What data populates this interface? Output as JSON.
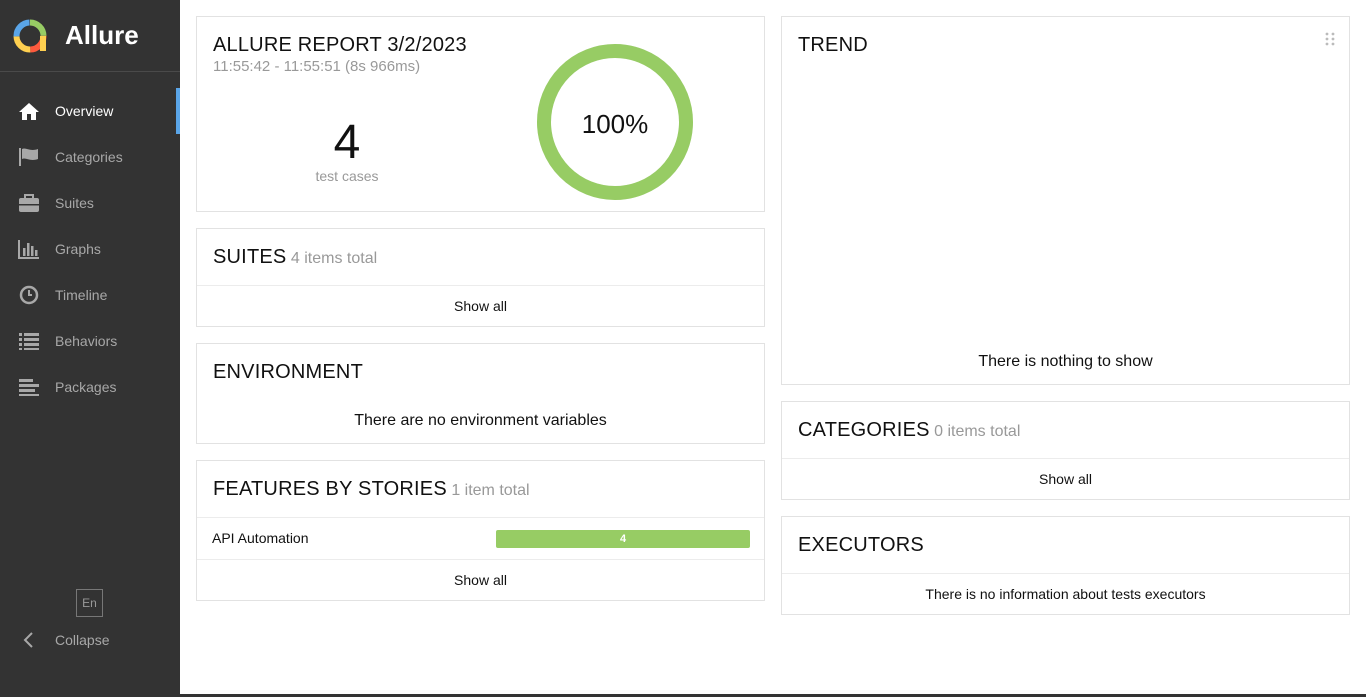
{
  "app": {
    "name": "Allure"
  },
  "sidebar": {
    "items": [
      {
        "label": "Overview",
        "icon": "home-icon",
        "active": true
      },
      {
        "label": "Categories",
        "icon": "flag-icon"
      },
      {
        "label": "Suites",
        "icon": "briefcase-icon"
      },
      {
        "label": "Graphs",
        "icon": "bar-chart-icon"
      },
      {
        "label": "Timeline",
        "icon": "clock-icon"
      },
      {
        "label": "Behaviors",
        "icon": "list-icon"
      },
      {
        "label": "Packages",
        "icon": "align-left-icon"
      }
    ],
    "language": "En",
    "collapse_label": "Collapse"
  },
  "summary": {
    "title": "ALLURE REPORT 3/2/2023",
    "time_range": "11:55:42 - 11:55:51 (8s 966ms)",
    "test_count": "4",
    "test_count_label": "test cases",
    "passed_percent_label": "100%",
    "passed_fraction": 1.0,
    "pass_color": "#97cc64"
  },
  "suites": {
    "title": "SUITES",
    "subtitle": "4 items total",
    "show_all": "Show all"
  },
  "environment": {
    "title": "ENVIRONMENT",
    "empty_text": "There are no environment variables"
  },
  "features": {
    "title": "FEATURES BY STORIES",
    "subtitle": "1 item total",
    "rows": [
      {
        "name": "API Automation",
        "count": "4"
      }
    ],
    "show_all": "Show all"
  },
  "trend": {
    "title": "TREND",
    "empty_text": "There is nothing to show"
  },
  "categories": {
    "title": "CATEGORIES",
    "subtitle": "0 items total",
    "show_all": "Show all"
  },
  "executors": {
    "title": "EXECUTORS",
    "empty_text": "There is no information about tests executors"
  }
}
